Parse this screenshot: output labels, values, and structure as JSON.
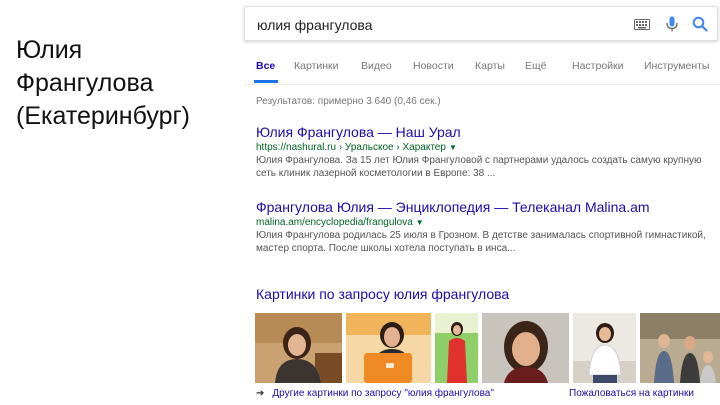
{
  "slide": {
    "title_lines": [
      "Юлия",
      "Франгулова",
      "(Екатеринбург)"
    ]
  },
  "search": {
    "query": "юлия франгулова",
    "icons": [
      "keyboard-icon",
      "microphone-icon",
      "search-icon"
    ]
  },
  "tabs": [
    "Все",
    "Картинки",
    "Видео",
    "Новости",
    "Карты",
    "Ещё",
    "Настройки",
    "Инструменты"
  ],
  "active_tab": "Все",
  "stats": "Результатов: примерно 3 640 (0,46 сек.)",
  "results": [
    {
      "title": "Юлия Франгулова — Наш Урал",
      "url": "https://nashural.ru › Уральское › Характер",
      "snippet": "Юлия Франгулова. За 15 лет Юлия Франгуловой с партнерами удалось создать самую крупную сеть клиник лазерной косметологии в Европе: 38 ..."
    },
    {
      "title": "Франгулова Юлия — Энциклопедия — Телеканал Malina.am",
      "url": "malina.am/encyclopedia/frangulova",
      "snippet": "Юлия Франгулова родилась 25 июля в Грозном. В детстве занималась спортивной гимнастикой, мастер спорта. После школы хотела поступать в инса..."
    }
  ],
  "images": {
    "heading": "Картинки по запросу юлия франгулова",
    "more_link": "Другие картинки по запросу \"юлия франгулова\"",
    "similar_link": "Пожаловаться на картинки",
    "colors": {
      "thumb1": "#c9a06c",
      "thumb2": "#f08a24",
      "thumb3": "#e0312e",
      "thumb4": "#c47a4a",
      "thumb5": "#e9e5df",
      "thumb6": "#9a8a70"
    }
  }
}
